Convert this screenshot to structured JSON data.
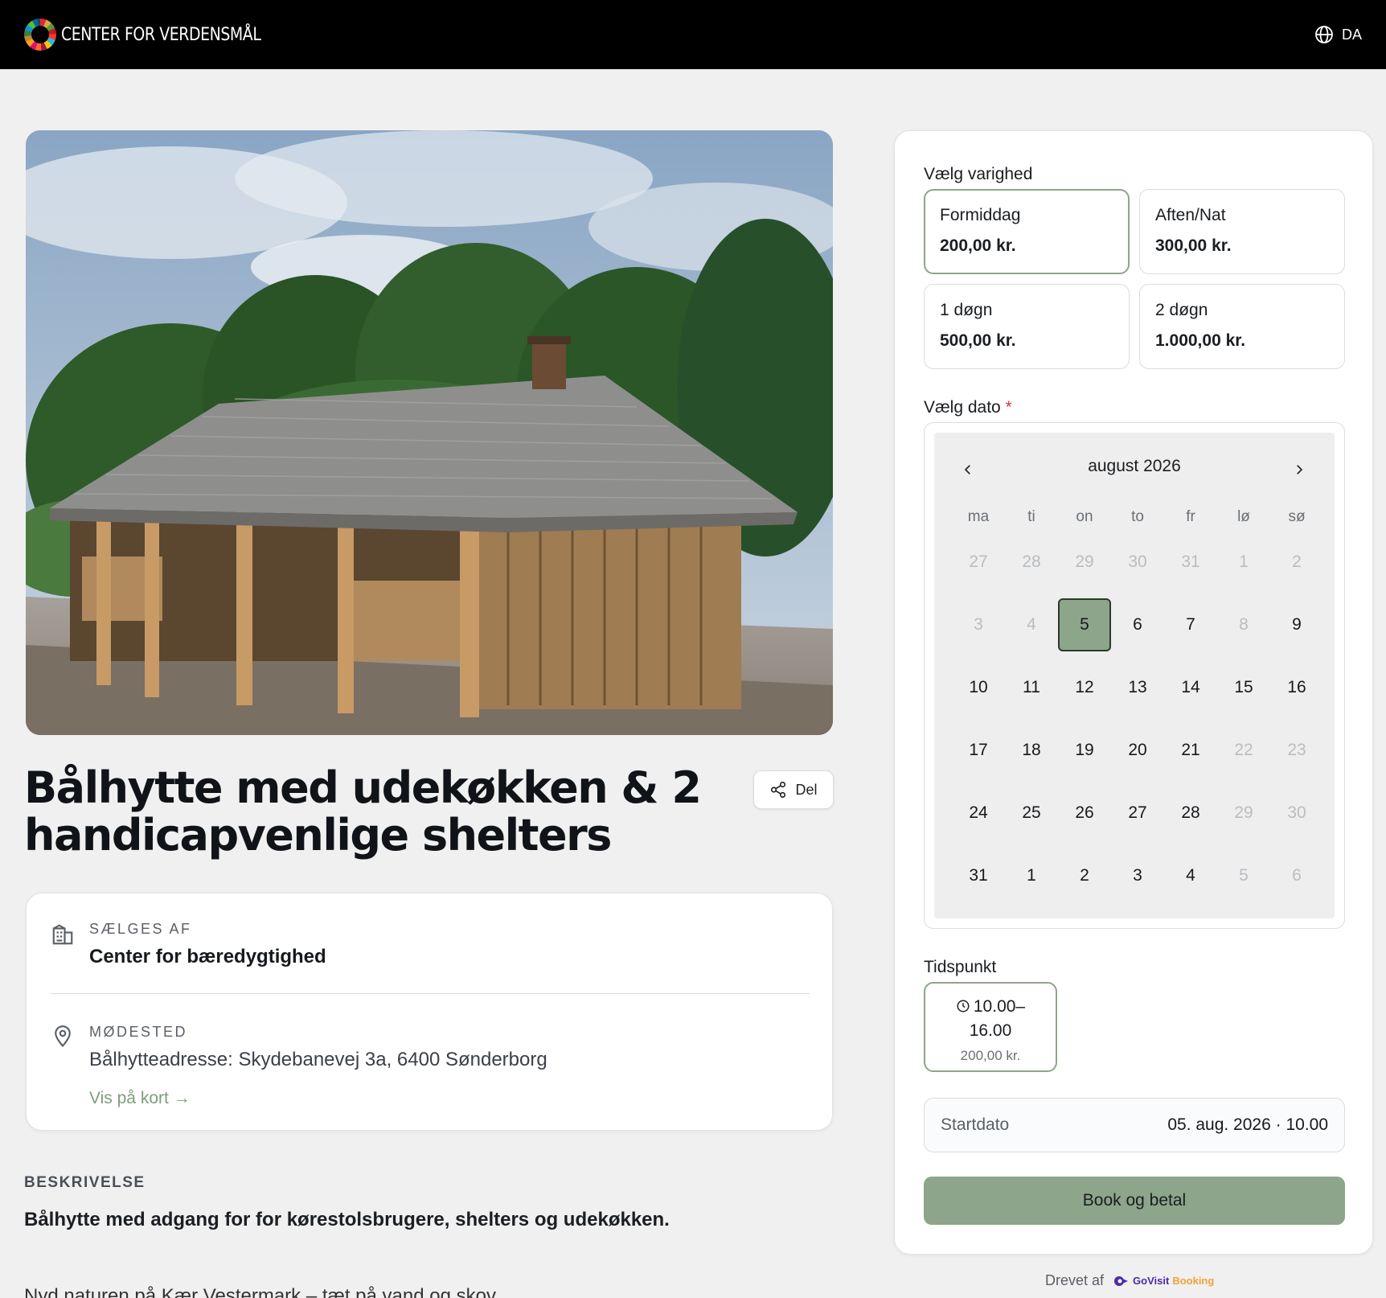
{
  "header": {
    "brand": "CENTER FOR VERDENSMÅL",
    "language": "DA"
  },
  "product": {
    "title": "Bålhytte med udekøkken & 2 handicapvenlige shelters",
    "share_label": "Del"
  },
  "info": {
    "seller_label": "SÆLGES AF",
    "seller_name": "Center for bæredygtighed",
    "meeting_label": "MØDESTED",
    "address": "Bålhytteadresse: Skydebanevej 3a, 6400 Sønderborg",
    "map_link": "Vis på kort →"
  },
  "description": {
    "label": "BESKRIVELSE",
    "lead": "Bålhytte med adgang for for kørestolsbrugere, shelters og udekøkken.",
    "body_cut": "Nyd naturen på Kær Vestermark – tæt på vand og skov"
  },
  "booking": {
    "duration_label": "Vælg varighed",
    "durations": [
      {
        "name": "Formiddag",
        "price": "200,00 kr.",
        "selected": true
      },
      {
        "name": "Aften/Nat",
        "price": "300,00 kr.",
        "selected": false
      },
      {
        "name": "1 døgn",
        "price": "500,00 kr.",
        "selected": false
      },
      {
        "name": "2 døgn",
        "price": "1.000,00 kr.",
        "selected": false
      }
    ],
    "date_label": "Vælg dato",
    "required_mark": "*",
    "calendar": {
      "month": "august 2026",
      "weekdays": [
        "ma",
        "ti",
        "on",
        "to",
        "fr",
        "lø",
        "sø"
      ],
      "weeks": [
        [
          {
            "d": "27",
            "m": true
          },
          {
            "d": "28",
            "m": true
          },
          {
            "d": "29",
            "m": true
          },
          {
            "d": "30",
            "m": true
          },
          {
            "d": "31",
            "m": true
          },
          {
            "d": "1",
            "m": true
          },
          {
            "d": "2",
            "m": true
          }
        ],
        [
          {
            "d": "3",
            "m": true
          },
          {
            "d": "4",
            "m": true
          },
          {
            "d": "5",
            "s": true
          },
          {
            "d": "6"
          },
          {
            "d": "7"
          },
          {
            "d": "8",
            "m": true
          },
          {
            "d": "9"
          }
        ],
        [
          {
            "d": "10"
          },
          {
            "d": "11"
          },
          {
            "d": "12"
          },
          {
            "d": "13"
          },
          {
            "d": "14"
          },
          {
            "d": "15"
          },
          {
            "d": "16"
          }
        ],
        [
          {
            "d": "17"
          },
          {
            "d": "18"
          },
          {
            "d": "19"
          },
          {
            "d": "20"
          },
          {
            "d": "21"
          },
          {
            "d": "22",
            "m": true
          },
          {
            "d": "23",
            "m": true
          }
        ],
        [
          {
            "d": "24"
          },
          {
            "d": "25"
          },
          {
            "d": "26"
          },
          {
            "d": "27"
          },
          {
            "d": "28"
          },
          {
            "d": "29",
            "m": true
          },
          {
            "d": "30",
            "m": true
          }
        ],
        [
          {
            "d": "31"
          },
          {
            "d": "1"
          },
          {
            "d": "2"
          },
          {
            "d": "3"
          },
          {
            "d": "4"
          },
          {
            "d": "5",
            "m": true
          },
          {
            "d": "6",
            "m": true
          }
        ]
      ]
    },
    "time_label": "Tidspunkt",
    "time_slot": {
      "line1": "10.00–",
      "line2": "16.00",
      "price": "200,00 kr."
    },
    "summary_label": "Startdato",
    "summary_value": "05. aug. 2026 · 10.00",
    "book_button": "Book og betal"
  },
  "footer": {
    "powered_by": "Drevet af",
    "logo_part1": "GoVisit",
    "logo_part2": "Booking"
  },
  "colors": {
    "accent": "#8da58a",
    "link": "#7f9c7c",
    "header_bg": "#000000",
    "page_bg": "#f0f0f0"
  }
}
